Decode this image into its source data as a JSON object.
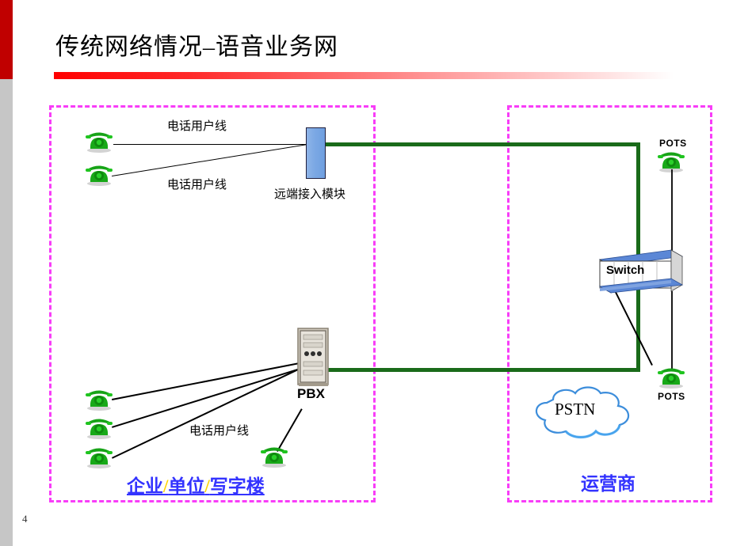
{
  "slide": {
    "title": "传统网络情况–语音业务网",
    "page_number": "4",
    "accent_red": "#c00000",
    "zone_border_color": "#f83df8",
    "link_green": "#1a6b1a",
    "label_blue": "#3333ff",
    "separator_gold": "#ffd400"
  },
  "zones": {
    "enterprise": {
      "label_part1": "企业",
      "sep1": "/",
      "label_part2": "单位",
      "sep2": "/",
      "label_part3": "写字楼"
    },
    "carrier": {
      "label": "运营商"
    }
  },
  "nodes": {
    "remote_access_module": {
      "label": "远端接入模块"
    },
    "pbx": {
      "label": "PBX"
    },
    "switch": {
      "label": "Switch"
    },
    "pstn": {
      "label": "PSTN"
    },
    "pots_top": {
      "label": "POTS"
    },
    "pots_bottom": {
      "label": "POTS"
    }
  },
  "link_labels": {
    "subscriber_line_1": "电话用户线",
    "subscriber_line_2": "电话用户线",
    "subscriber_line_3": "电话用户线"
  },
  "icons": {
    "phone": "telephone-icon",
    "switch": "network-switch-icon",
    "pbx": "pbx-cabinet-icon",
    "cloud": "cloud-icon",
    "module": "access-module-icon"
  }
}
